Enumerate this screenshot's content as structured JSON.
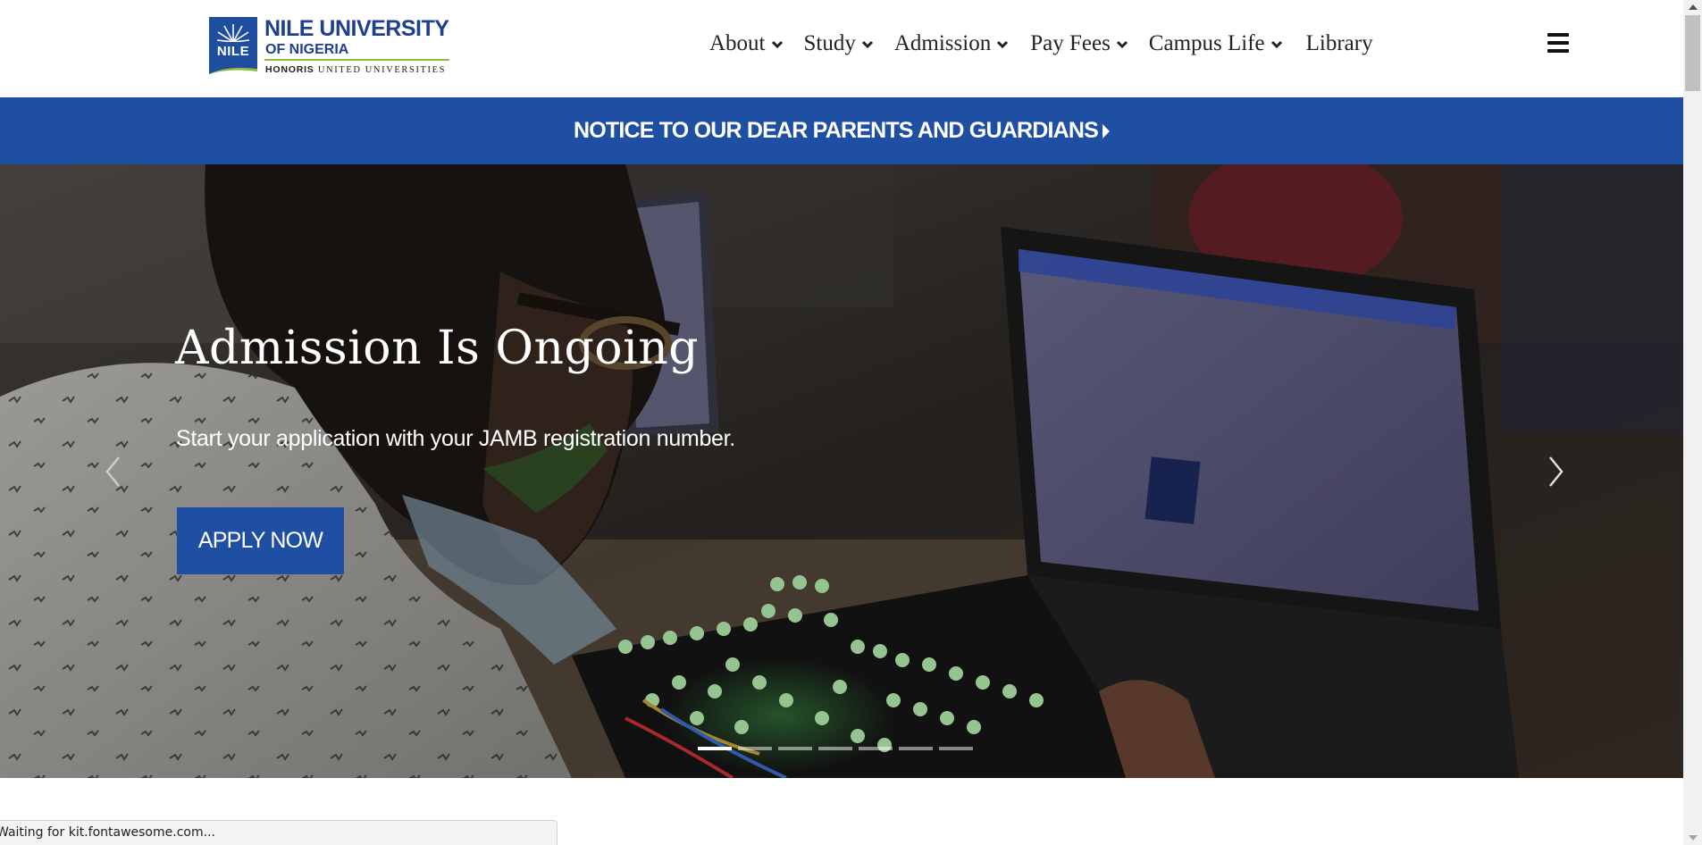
{
  "header": {
    "logo": {
      "mark_text": "NILE",
      "name_line1": "NILE UNIVERSITY",
      "name_line2": "OF NIGERIA",
      "tagline_bold": "HONORIS",
      "tagline_rest": "UNITED UNIVERSITIES"
    },
    "nav": [
      {
        "label": "About",
        "dropdown": true
      },
      {
        "label": "Study",
        "dropdown": true
      },
      {
        "label": "Admission",
        "dropdown": true
      },
      {
        "label": "Pay Fees",
        "dropdown": true
      },
      {
        "label": "Campus Life",
        "dropdown": true
      },
      {
        "label": "Library",
        "dropdown": false
      }
    ],
    "menu_icon": "hamburger-menu-icon"
  },
  "notice": {
    "text": "NOTICE TO OUR DEAR PARENTS AND GUARDIANS",
    "icon": "caret-right-icon"
  },
  "hero": {
    "title": "Admission Is Ongoing",
    "subtitle": "Start your application with your JAMB registration number.",
    "cta_label": "APPLY NOW",
    "slide_count": 7,
    "active_slide": 1
  },
  "status_bar": {
    "text": "Waiting for kit.fontawesome.com..."
  },
  "colors": {
    "brand_blue": "#1f4fa2",
    "logo_green": "#8bbd3a",
    "nav_text": "#222222"
  }
}
